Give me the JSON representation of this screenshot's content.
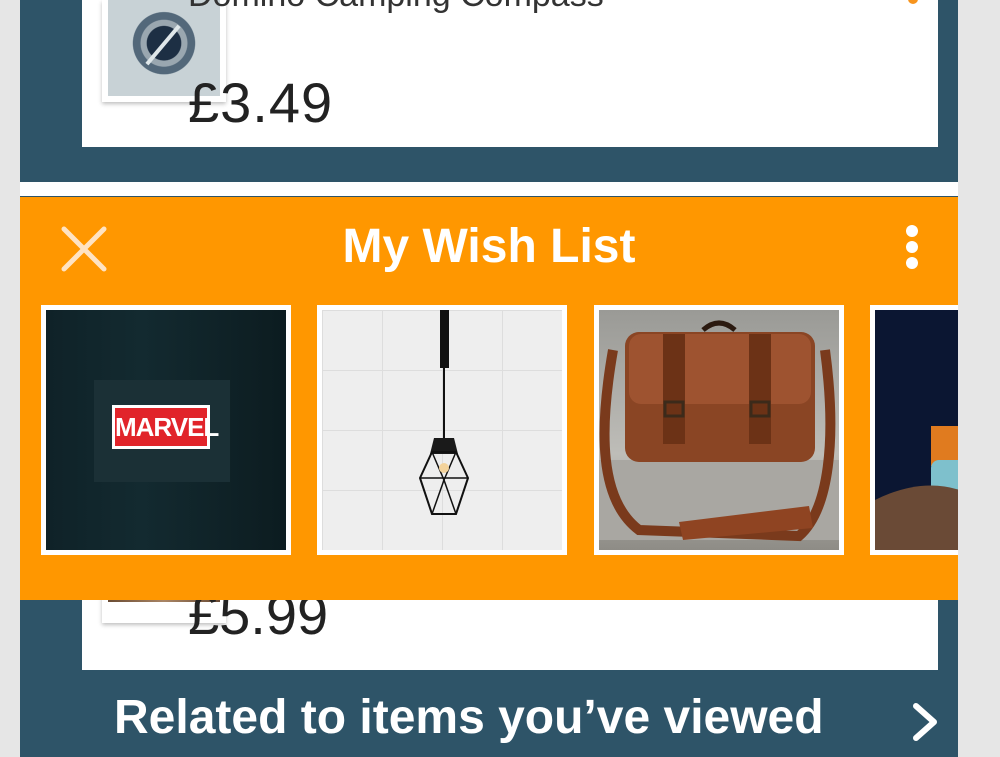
{
  "top_product": {
    "title": "Domino Camping Compass",
    "price": "£3.49",
    "thumb_icon": "compass-image"
  },
  "wish_list": {
    "title": "My Wish List",
    "close_icon": "close-icon",
    "more_icon": "more-vertical-icon",
    "items": [
      {
        "name": "marvel-sign-image",
        "logo_text": "MARVEL"
      },
      {
        "name": "pendant-lamp-image"
      },
      {
        "name": "leather-bag-image"
      },
      {
        "name": "cup-image"
      }
    ]
  },
  "bottom_product": {
    "price": "£5.99"
  },
  "related": {
    "label": "Related to items you’ve viewed",
    "chevron_icon": "chevron-right-icon"
  },
  "colors": {
    "accent": "#ff9700",
    "background": "#2e5468",
    "card": "#ffffff"
  }
}
